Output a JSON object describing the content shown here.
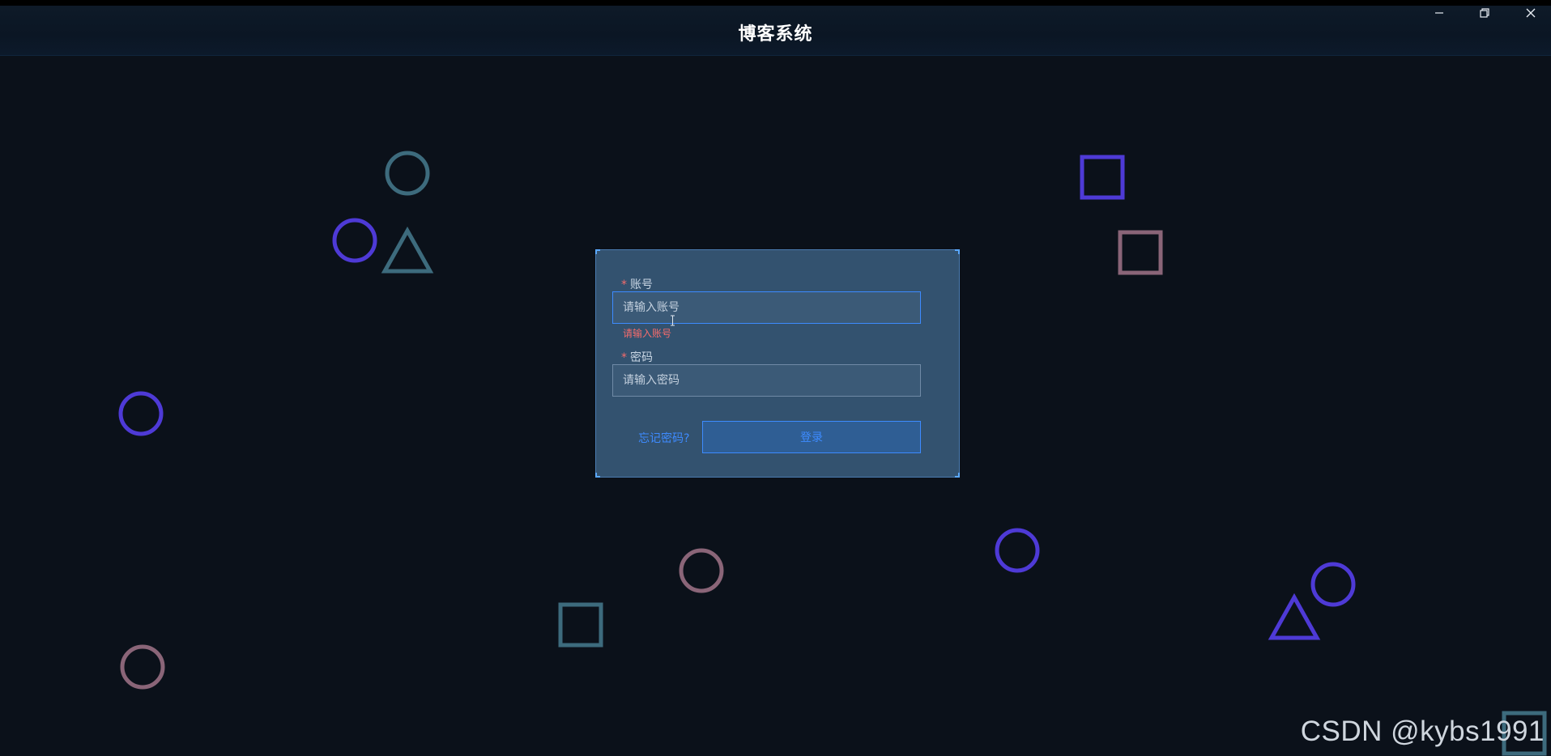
{
  "window": {
    "title": "博客系统",
    "controls": [
      "minimize-icon",
      "restore-icon",
      "close-icon"
    ]
  },
  "login": {
    "account_label": "账号",
    "account_placeholder": "请输入账号",
    "account_error": "请输入账号",
    "password_label": "密码",
    "password_placeholder": "请输入密码",
    "required_mark": "*",
    "forgot_label": "忘记密码?",
    "submit_label": "登录"
  },
  "watermark": "CSDN @kybs1991",
  "colors": {
    "background": "#0b111a",
    "card": "#33526f",
    "accent": "#3d8bff",
    "error": "#f56c6c",
    "shape_teal": "#3d6b7d",
    "shape_purple": "#4e3ad6",
    "shape_mauve": "#8a6578"
  },
  "background_shapes": [
    {
      "kind": "circle",
      "color": "teal"
    },
    {
      "kind": "circle",
      "color": "purple"
    },
    {
      "kind": "triangle",
      "color": "teal"
    },
    {
      "kind": "square",
      "color": "purple"
    },
    {
      "kind": "square",
      "color": "mauve"
    },
    {
      "kind": "circle",
      "color": "purple"
    },
    {
      "kind": "circle",
      "color": "mauve"
    },
    {
      "kind": "circle",
      "color": "purple"
    },
    {
      "kind": "circle",
      "color": "purple"
    },
    {
      "kind": "triangle",
      "color": "purple"
    },
    {
      "kind": "square",
      "color": "teal"
    },
    {
      "kind": "circle",
      "color": "mauve"
    },
    {
      "kind": "square",
      "color": "teal"
    }
  ]
}
